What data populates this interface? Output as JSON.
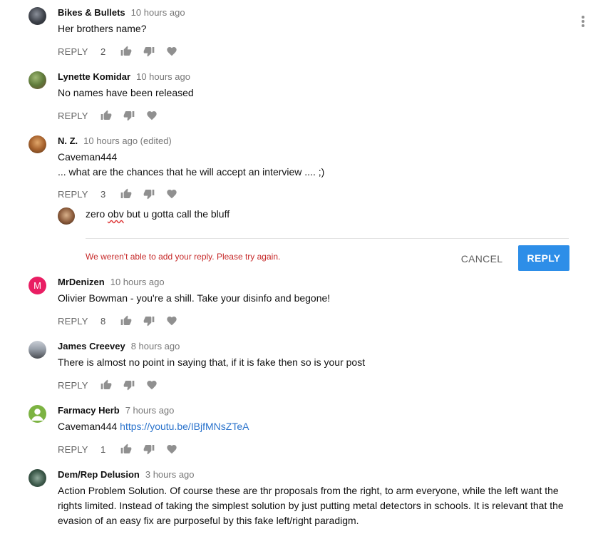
{
  "colors": {
    "link": "#2a73cc",
    "error": "#c62828",
    "reply_button_bg": "#2d8ee8",
    "action_icon": "#909090",
    "avatar_mrdenizen": "#e91e63"
  },
  "icons": {
    "like": "thumb-up-icon",
    "dislike": "thumb-down-icon",
    "heart": "heart-icon",
    "menu": "more-vertical-icon"
  },
  "comments": [
    {
      "author": "Bikes & Bullets",
      "time": "10 hours ago",
      "text": "Her brothers name?",
      "reply": "REPLY",
      "likes": "2"
    },
    {
      "author": "Lynette Komidar",
      "time": "10 hours ago",
      "text": "No names have been released",
      "reply": "REPLY",
      "likes": ""
    },
    {
      "author": "N. Z.",
      "time": "10 hours ago (edited)",
      "text_line1": "Caveman444",
      "text_line2": "... what are the chances that he will accept an interview .... ;)",
      "reply": "REPLY",
      "likes": "3"
    },
    {
      "author": "MrDenizen",
      "avatar_letter": "M",
      "time": "10 hours ago",
      "text": "Olivier Bowman - you're a shill. Take your disinfo and begone!",
      "reply": "REPLY",
      "likes": "8"
    },
    {
      "author": "James Creevey",
      "time": "8 hours ago",
      "text": "There is almost no point in saying that, if it is fake then so is your post",
      "reply": "REPLY",
      "likes": ""
    },
    {
      "author": "Farmacy Herb",
      "time": "7 hours ago",
      "text_prefix": "Caveman444 ",
      "link": "https://youtu.be/IBjfMNsZTeA",
      "reply": "REPLY",
      "likes": "1"
    },
    {
      "author": "Dem/Rep Delusion",
      "time": "3 hours ago",
      "text": "Action Problem Solution. Of course these are thr proposals from the right, to arm everyone, while the left want the rights limited.  Instead of taking the simplest solution by just putting metal detectors in schools. It is relevant that the evasion of an easy fix are purposeful by this fake left/right paradigm."
    }
  ],
  "reply_box": {
    "input_before": "zero ",
    "input_misspelled": "obv",
    "input_after": " but u gotta call the bluff",
    "error": "We weren't able to add your reply. Please try again.",
    "cancel_label": "CANCEL",
    "reply_label": "REPLY"
  }
}
